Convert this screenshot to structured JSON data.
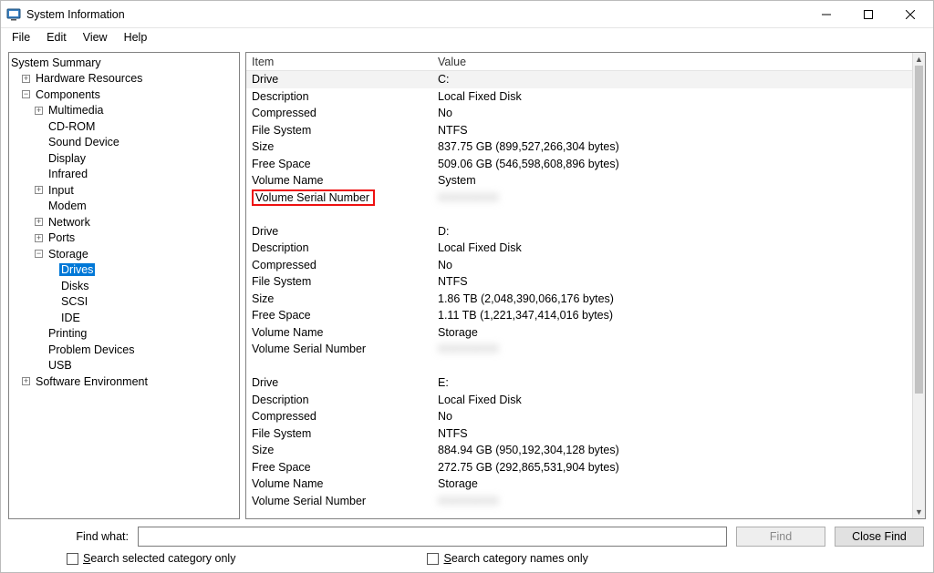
{
  "window": {
    "title": "System Information"
  },
  "menu": {
    "file": "File",
    "edit": "Edit",
    "view": "View",
    "help": "Help"
  },
  "tree": {
    "system_summary": "System Summary",
    "hardware_resources": "Hardware Resources",
    "components": "Components",
    "multimedia": "Multimedia",
    "cdrom": "CD-ROM",
    "sound_device": "Sound Device",
    "display": "Display",
    "infrared": "Infrared",
    "input": "Input",
    "modem": "Modem",
    "network": "Network",
    "ports": "Ports",
    "storage": "Storage",
    "drives": "Drives",
    "disks": "Disks",
    "scsi": "SCSI",
    "ide": "IDE",
    "printing": "Printing",
    "problem_devices": "Problem Devices",
    "usb": "USB",
    "software_environment": "Software Environment"
  },
  "details": {
    "headers": {
      "item": "Item",
      "value": "Value"
    },
    "labels": {
      "drive": "Drive",
      "description": "Description",
      "compressed": "Compressed",
      "file_system": "File System",
      "size": "Size",
      "free_space": "Free Space",
      "volume_name": "Volume Name",
      "volume_serial_number": "Volume Serial Number"
    },
    "drives": [
      {
        "drive": "C:",
        "description": "Local Fixed Disk",
        "compressed": "No",
        "file_system": "NTFS",
        "size": "837.75 GB (899,527,266,304 bytes)",
        "free_space": "509.06 GB (546,598,608,896 bytes)",
        "volume_name": "System",
        "volume_serial_number": "XXXXXXXX"
      },
      {
        "drive": "D:",
        "description": "Local Fixed Disk",
        "compressed": "No",
        "file_system": "NTFS",
        "size": "1.86 TB (2,048,390,066,176 bytes)",
        "free_space": "1.11 TB (1,221,347,414,016 bytes)",
        "volume_name": "Storage",
        "volume_serial_number": "XXXXXXXX"
      },
      {
        "drive": "E:",
        "description": "Local Fixed Disk",
        "compressed": "No",
        "file_system": "NTFS",
        "size": "884.94 GB (950,192,304,128 bytes)",
        "free_space": "272.75 GB (292,865,531,904 bytes)",
        "volume_name": "Storage",
        "volume_serial_number": "XXXXXXXX"
      }
    ]
  },
  "footer": {
    "find_what_label": "Find what:",
    "find_button": "Find",
    "close_find_button": "Close Find",
    "search_selected_label_pre": "S",
    "search_selected_label": "earch selected category only",
    "search_names_label_pre": "S",
    "search_names_label": "earch category names only"
  }
}
